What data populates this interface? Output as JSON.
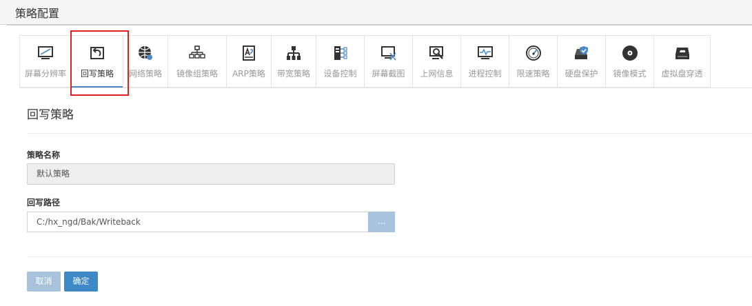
{
  "header": {
    "title": "策略配置"
  },
  "tabs": [
    {
      "label": "屏幕分辨率",
      "icon": "monitor-resolution-icon"
    },
    {
      "label": "回写策略",
      "icon": "writeback-icon",
      "active": true
    },
    {
      "label": "网络策略",
      "icon": "network-globe-icon"
    },
    {
      "label": "镜像组策略",
      "icon": "image-group-icon"
    },
    {
      "label": "ARP策略",
      "icon": "arp-book-icon"
    },
    {
      "label": "带宽策略",
      "icon": "bandwidth-tree-icon"
    },
    {
      "label": "设备控制",
      "icon": "device-control-icon"
    },
    {
      "label": "屏幕截图",
      "icon": "screenshot-icon"
    },
    {
      "label": "上网信息",
      "icon": "internet-info-icon"
    },
    {
      "label": "进程控制",
      "icon": "process-monitor-icon"
    },
    {
      "label": "限速策略",
      "icon": "speed-gauge-icon"
    },
    {
      "label": "硬盘保护",
      "icon": "disk-protect-icon"
    },
    {
      "label": "镜像模式",
      "icon": "disc-icon"
    },
    {
      "label": "虚拟盘穿透",
      "icon": "virtual-disk-icon"
    }
  ],
  "section": {
    "title": "回写策略"
  },
  "form": {
    "name_label": "策略名称",
    "name_value": "默认策略",
    "path_label": "回写路径",
    "path_value": "C:/hx_ngd/Bak/Writeback",
    "browse_label": "..."
  },
  "buttons": {
    "cancel": "取消",
    "ok": "确定"
  },
  "colors": {
    "accent": "#3f88c8",
    "highlight": "#e02020",
    "icon": "#333333"
  }
}
